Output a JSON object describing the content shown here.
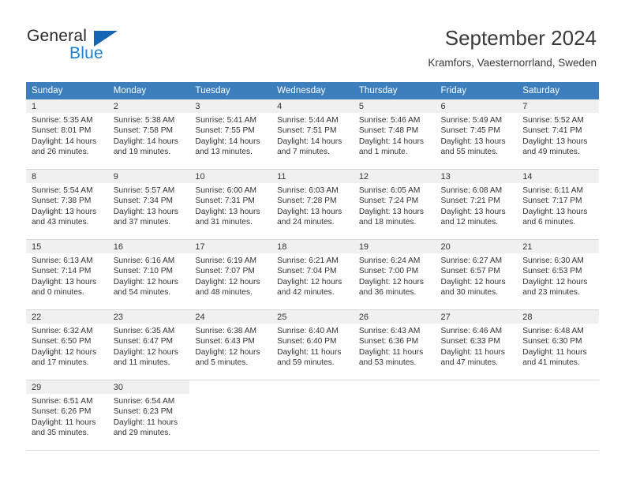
{
  "logo": {
    "word_top": "General",
    "word_bottom": "Blue",
    "triangle_color": "#1565b5",
    "blue_text_color": "#1f7fd0"
  },
  "header": {
    "title": "September 2024",
    "subtitle": "Kramfors, Vaesternorrland, Sweden"
  },
  "theme": {
    "header_row_bg": "#3d7ebd",
    "daynum_bg": "#f0f0f0",
    "row_border": "#d7d7d7",
    "text": "#333333"
  },
  "weekdays": [
    "Sunday",
    "Monday",
    "Tuesday",
    "Wednesday",
    "Thursday",
    "Friday",
    "Saturday"
  ],
  "weeks": [
    [
      {
        "day": "1",
        "sunrise": "Sunrise: 5:35 AM",
        "sunset": "Sunset: 8:01 PM",
        "daylight1": "Daylight: 14 hours",
        "daylight2": "and 26 minutes."
      },
      {
        "day": "2",
        "sunrise": "Sunrise: 5:38 AM",
        "sunset": "Sunset: 7:58 PM",
        "daylight1": "Daylight: 14 hours",
        "daylight2": "and 19 minutes."
      },
      {
        "day": "3",
        "sunrise": "Sunrise: 5:41 AM",
        "sunset": "Sunset: 7:55 PM",
        "daylight1": "Daylight: 14 hours",
        "daylight2": "and 13 minutes."
      },
      {
        "day": "4",
        "sunrise": "Sunrise: 5:44 AM",
        "sunset": "Sunset: 7:51 PM",
        "daylight1": "Daylight: 14 hours",
        "daylight2": "and 7 minutes."
      },
      {
        "day": "5",
        "sunrise": "Sunrise: 5:46 AM",
        "sunset": "Sunset: 7:48 PM",
        "daylight1": "Daylight: 14 hours",
        "daylight2": "and 1 minute."
      },
      {
        "day": "6",
        "sunrise": "Sunrise: 5:49 AM",
        "sunset": "Sunset: 7:45 PM",
        "daylight1": "Daylight: 13 hours",
        "daylight2": "and 55 minutes."
      },
      {
        "day": "7",
        "sunrise": "Sunrise: 5:52 AM",
        "sunset": "Sunset: 7:41 PM",
        "daylight1": "Daylight: 13 hours",
        "daylight2": "and 49 minutes."
      }
    ],
    [
      {
        "day": "8",
        "sunrise": "Sunrise: 5:54 AM",
        "sunset": "Sunset: 7:38 PM",
        "daylight1": "Daylight: 13 hours",
        "daylight2": "and 43 minutes."
      },
      {
        "day": "9",
        "sunrise": "Sunrise: 5:57 AM",
        "sunset": "Sunset: 7:34 PM",
        "daylight1": "Daylight: 13 hours",
        "daylight2": "and 37 minutes."
      },
      {
        "day": "10",
        "sunrise": "Sunrise: 6:00 AM",
        "sunset": "Sunset: 7:31 PM",
        "daylight1": "Daylight: 13 hours",
        "daylight2": "and 31 minutes."
      },
      {
        "day": "11",
        "sunrise": "Sunrise: 6:03 AM",
        "sunset": "Sunset: 7:28 PM",
        "daylight1": "Daylight: 13 hours",
        "daylight2": "and 24 minutes."
      },
      {
        "day": "12",
        "sunrise": "Sunrise: 6:05 AM",
        "sunset": "Sunset: 7:24 PM",
        "daylight1": "Daylight: 13 hours",
        "daylight2": "and 18 minutes."
      },
      {
        "day": "13",
        "sunrise": "Sunrise: 6:08 AM",
        "sunset": "Sunset: 7:21 PM",
        "daylight1": "Daylight: 13 hours",
        "daylight2": "and 12 minutes."
      },
      {
        "day": "14",
        "sunrise": "Sunrise: 6:11 AM",
        "sunset": "Sunset: 7:17 PM",
        "daylight1": "Daylight: 13 hours",
        "daylight2": "and 6 minutes."
      }
    ],
    [
      {
        "day": "15",
        "sunrise": "Sunrise: 6:13 AM",
        "sunset": "Sunset: 7:14 PM",
        "daylight1": "Daylight: 13 hours",
        "daylight2": "and 0 minutes."
      },
      {
        "day": "16",
        "sunrise": "Sunrise: 6:16 AM",
        "sunset": "Sunset: 7:10 PM",
        "daylight1": "Daylight: 12 hours",
        "daylight2": "and 54 minutes."
      },
      {
        "day": "17",
        "sunrise": "Sunrise: 6:19 AM",
        "sunset": "Sunset: 7:07 PM",
        "daylight1": "Daylight: 12 hours",
        "daylight2": "and 48 minutes."
      },
      {
        "day": "18",
        "sunrise": "Sunrise: 6:21 AM",
        "sunset": "Sunset: 7:04 PM",
        "daylight1": "Daylight: 12 hours",
        "daylight2": "and 42 minutes."
      },
      {
        "day": "19",
        "sunrise": "Sunrise: 6:24 AM",
        "sunset": "Sunset: 7:00 PM",
        "daylight1": "Daylight: 12 hours",
        "daylight2": "and 36 minutes."
      },
      {
        "day": "20",
        "sunrise": "Sunrise: 6:27 AM",
        "sunset": "Sunset: 6:57 PM",
        "daylight1": "Daylight: 12 hours",
        "daylight2": "and 30 minutes."
      },
      {
        "day": "21",
        "sunrise": "Sunrise: 6:30 AM",
        "sunset": "Sunset: 6:53 PM",
        "daylight1": "Daylight: 12 hours",
        "daylight2": "and 23 minutes."
      }
    ],
    [
      {
        "day": "22",
        "sunrise": "Sunrise: 6:32 AM",
        "sunset": "Sunset: 6:50 PM",
        "daylight1": "Daylight: 12 hours",
        "daylight2": "and 17 minutes."
      },
      {
        "day": "23",
        "sunrise": "Sunrise: 6:35 AM",
        "sunset": "Sunset: 6:47 PM",
        "daylight1": "Daylight: 12 hours",
        "daylight2": "and 11 minutes."
      },
      {
        "day": "24",
        "sunrise": "Sunrise: 6:38 AM",
        "sunset": "Sunset: 6:43 PM",
        "daylight1": "Daylight: 12 hours",
        "daylight2": "and 5 minutes."
      },
      {
        "day": "25",
        "sunrise": "Sunrise: 6:40 AM",
        "sunset": "Sunset: 6:40 PM",
        "daylight1": "Daylight: 11 hours",
        "daylight2": "and 59 minutes."
      },
      {
        "day": "26",
        "sunrise": "Sunrise: 6:43 AM",
        "sunset": "Sunset: 6:36 PM",
        "daylight1": "Daylight: 11 hours",
        "daylight2": "and 53 minutes."
      },
      {
        "day": "27",
        "sunrise": "Sunrise: 6:46 AM",
        "sunset": "Sunset: 6:33 PM",
        "daylight1": "Daylight: 11 hours",
        "daylight2": "and 47 minutes."
      },
      {
        "day": "28",
        "sunrise": "Sunrise: 6:48 AM",
        "sunset": "Sunset: 6:30 PM",
        "daylight1": "Daylight: 11 hours",
        "daylight2": "and 41 minutes."
      }
    ],
    [
      {
        "day": "29",
        "sunrise": "Sunrise: 6:51 AM",
        "sunset": "Sunset: 6:26 PM",
        "daylight1": "Daylight: 11 hours",
        "daylight2": "and 35 minutes."
      },
      {
        "day": "30",
        "sunrise": "Sunrise: 6:54 AM",
        "sunset": "Sunset: 6:23 PM",
        "daylight1": "Daylight: 11 hours",
        "daylight2": "and 29 minutes."
      },
      {
        "day": "",
        "sunrise": "",
        "sunset": "",
        "daylight1": "",
        "daylight2": ""
      },
      {
        "day": "",
        "sunrise": "",
        "sunset": "",
        "daylight1": "",
        "daylight2": ""
      },
      {
        "day": "",
        "sunrise": "",
        "sunset": "",
        "daylight1": "",
        "daylight2": ""
      },
      {
        "day": "",
        "sunrise": "",
        "sunset": "",
        "daylight1": "",
        "daylight2": ""
      },
      {
        "day": "",
        "sunrise": "",
        "sunset": "",
        "daylight1": "",
        "daylight2": ""
      }
    ]
  ]
}
